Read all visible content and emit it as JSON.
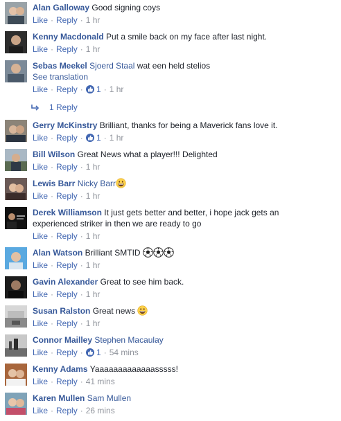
{
  "actions": {
    "like": "Like",
    "reply": "Reply",
    "dot": "·"
  },
  "comments": [
    {
      "author": "Alan Galloway",
      "tag": "",
      "text": "Good signing coys",
      "time": "1 hr",
      "likes": ""
    },
    {
      "author": "Kenny Macdonald",
      "tag": "",
      "text": "Put a smile back on my face after last night.",
      "time": "1 hr",
      "likes": ""
    },
    {
      "author": "Sebas Meekel",
      "tag": "Sjoerd Staal",
      "text": "wat een held stelios",
      "see_translation": "See translation",
      "time": "1 hr",
      "likes": "1"
    },
    {
      "author": "Gerry McKinstry",
      "tag": "",
      "text": "Brilliant, thanks for being a Maverick fans love it.",
      "time": "1 hr",
      "likes": "1"
    },
    {
      "author": "Bill Wilson",
      "tag": "",
      "text": "Great News what a player!!! Delighted",
      "time": "1 hr",
      "likes": ""
    },
    {
      "author": "Lewis Barr",
      "tag": "Nicky Barr",
      "text": "",
      "time": "1 hr",
      "likes": ""
    },
    {
      "author": "Derek Williamson",
      "tag": "",
      "text_line1": "It just gets better and better, i hope jack gets an",
      "text_line2": "experienced striker in then we are ready to go",
      "time": "1 hr",
      "likes": ""
    },
    {
      "author": "Alan Watson",
      "tag": "",
      "text": "Brilliant SMTID",
      "time": "1 hr",
      "likes": ""
    },
    {
      "author": "Gavin Alexander",
      "tag": "",
      "text": "Great to see him back.",
      "time": "1 hr",
      "likes": ""
    },
    {
      "author": "Susan Ralston",
      "tag": "",
      "text": "Great news",
      "time": "1 hr",
      "likes": ""
    },
    {
      "author": "Connor Mailley",
      "tag": "Stephen Macaulay",
      "text": "",
      "time": "54 mins",
      "likes": "1"
    },
    {
      "author": "Kenny Adams",
      "tag": "",
      "text": "Yaaaaaaaaaaaaasssss!",
      "time": "41 mins",
      "likes": ""
    },
    {
      "author": "Karen Mullen",
      "tag": "Sam Mullen",
      "text": "",
      "time": "26 mins",
      "likes": ""
    }
  ],
  "reply_thread": {
    "label": "1 Reply"
  },
  "icons": {
    "reply_arrow": "reply-arrow-icon",
    "like_badge": "like-reaction-icon",
    "smiley": "grinning-face-icon",
    "smile": "smiling-face-icon",
    "football": "soccer-ball-icon"
  },
  "colors": {
    "link": "#365899",
    "action": "#4267b2",
    "meta": "#90949c",
    "text": "#1d2129"
  }
}
